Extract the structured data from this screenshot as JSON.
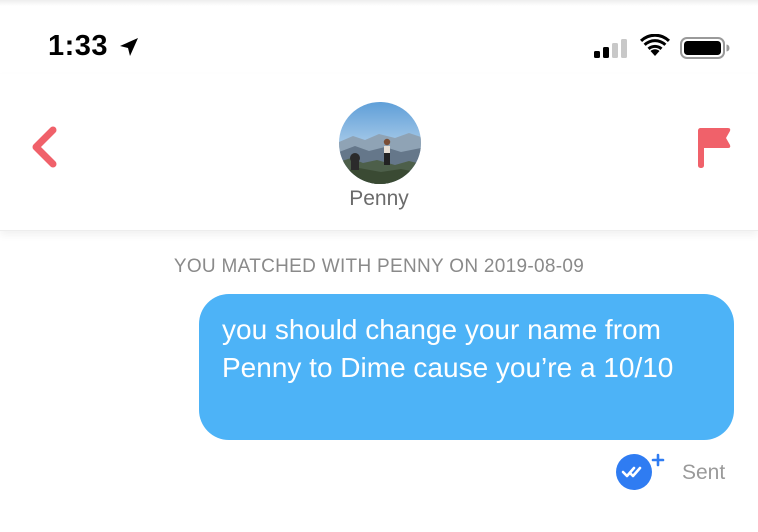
{
  "status_bar": {
    "time": "1:33",
    "icons": [
      "location-arrow-icon",
      "cellular-signal-icon",
      "wifi-icon",
      "battery-icon"
    ]
  },
  "header": {
    "back_icon": "chevron-left-icon",
    "flag_icon": "flag-icon",
    "match_name": "Penny",
    "accent_color": "#f0616a"
  },
  "conversation": {
    "match_banner": "YOU MATCHED WITH PENNY ON 2019-08-09",
    "messages": [
      {
        "text": "you should change your name from Penny to Dime cause you’re a 10/10",
        "sender": "me",
        "bubble_color": "#4db3f7"
      }
    ],
    "status_icon": "double-check-plus-icon",
    "status": "Sent"
  }
}
